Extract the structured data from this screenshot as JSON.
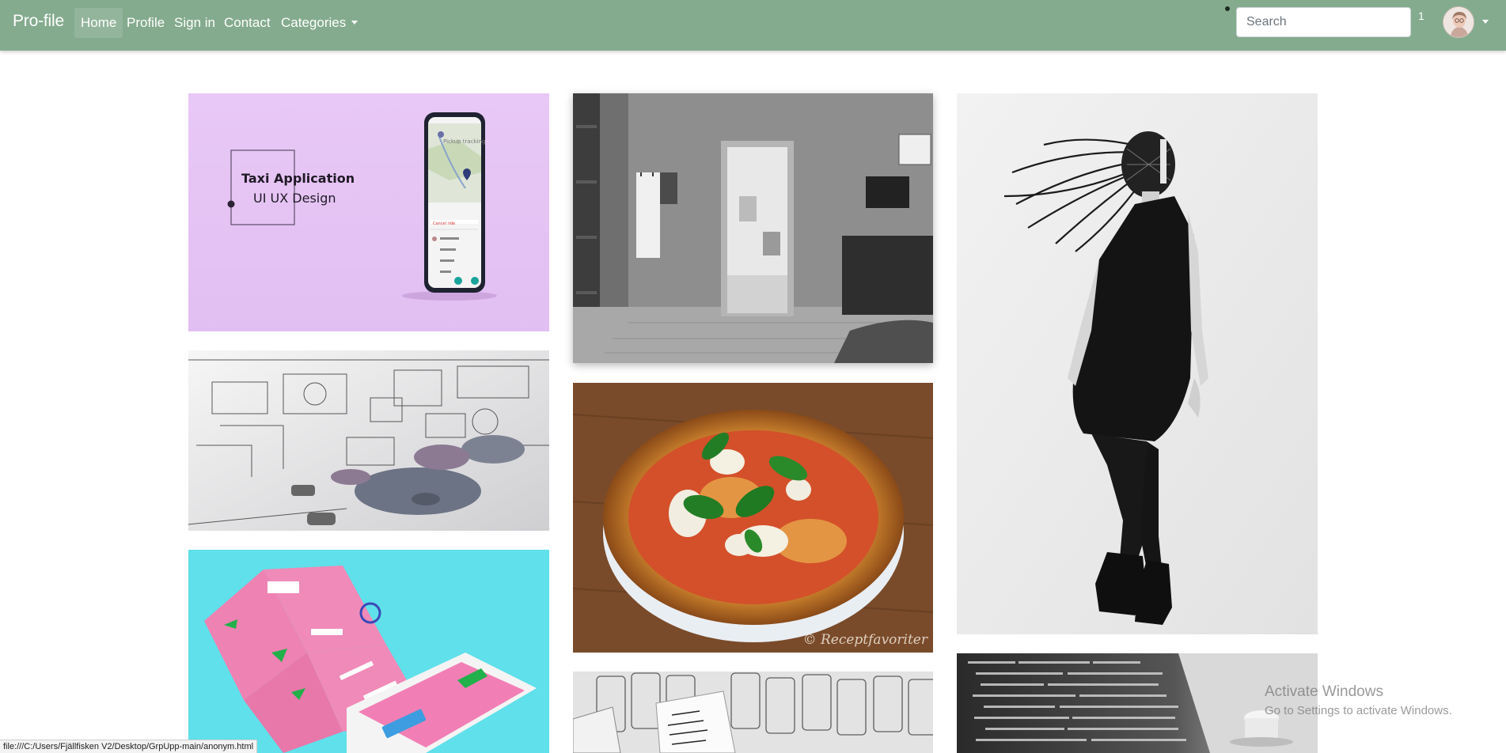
{
  "navbar": {
    "brand": "Pro-file",
    "links": [
      "Home",
      "Profile",
      "Sign in",
      "Contact"
    ],
    "categories": "Categories",
    "search_placeholder": "Search",
    "notification_count": "1"
  },
  "gallery": {
    "taxi": {
      "title": "Taxi Application",
      "subtitle": "UI UX Design",
      "phone_header": "Pickup tracking",
      "cancel": "Cancel ride"
    },
    "pizza": {
      "watermark": "© Receptfavoriter"
    }
  },
  "os": {
    "activate_title": "Activate Windows",
    "activate_sub": "Go to Settings to activate Windows.",
    "status_url": "file:///C:/Users/Fjällfisken V2/Desktop/GrpUpp-main/anonym.html"
  },
  "colors": {
    "navbar": "#84ab8e",
    "taxi_bg": "#e8c8f6",
    "flyer_bg": "#5fe0ea"
  }
}
